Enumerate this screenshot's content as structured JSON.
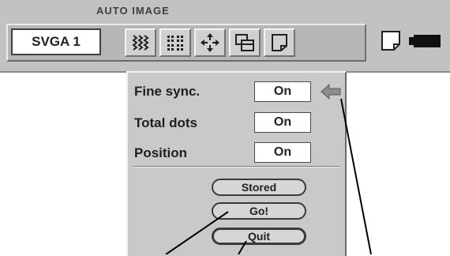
{
  "toolbar": {
    "title": "AUTO IMAGE",
    "mode": "SVGA 1",
    "icons": [
      "checkerboard-pattern-icon",
      "dot-grid-icon",
      "position-arrows-icon",
      "window-overlap-icon",
      "page-icon"
    ]
  },
  "dialog": {
    "rows": [
      {
        "label": "Fine sync.",
        "value": "On"
      },
      {
        "label": "Total dots",
        "value": "On"
      },
      {
        "label": "Position",
        "value": "On"
      }
    ],
    "buttons": {
      "stored": "Stored",
      "go": "Go!",
      "quit": "Quit"
    }
  },
  "colors": {
    "panel": "#c9c9c9",
    "toolbar": "#c2c2c2",
    "arrow": "#8c8c8c"
  }
}
